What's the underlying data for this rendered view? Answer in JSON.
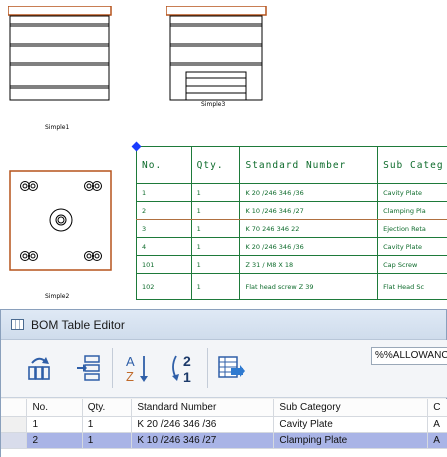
{
  "drawing": {
    "views": [
      {
        "name": "Simple1"
      },
      {
        "name": "Simple3"
      },
      {
        "name": "Simple2"
      }
    ],
    "bom_table": {
      "headers": [
        "No.",
        "Qty.",
        "Standard Number",
        "Sub Categ"
      ],
      "rows": [
        [
          "1",
          "1",
          "K 20 /246 346 /36",
          "Cavity Plate"
        ],
        [
          "2",
          "1",
          "K 10 /246 346 /27",
          "Clamping Pla"
        ],
        [
          "3",
          "1",
          "K 70 246 346 22",
          "Ejection Reta"
        ],
        [
          "4",
          "1",
          "K 20 /246 346 /36",
          "Cavity Plate"
        ],
        [
          "101",
          "1",
          "Z 31 / M8 X 18",
          "Cap Screw"
        ],
        [
          "102",
          "1",
          "Flat head screw Z 39",
          "Flat Head Sc"
        ]
      ]
    }
  },
  "bom_editor": {
    "title": "BOM Table Editor",
    "toolbar": {
      "allowance_value": "%%ALLOWANC",
      "icons": [
        "refresh-bom-icon",
        "column-edit-icon",
        "sort-alpha-icon",
        "sort-numeric-icon",
        "export-table-icon"
      ]
    },
    "columns": [
      "No.",
      "Qty.",
      "Standard Number",
      "Sub Category",
      "C"
    ],
    "rows": [
      {
        "no": "1",
        "qty": "1",
        "standard": "K 20 /246 346 /36",
        "sub": "Cavity Plate",
        "extra": "A",
        "selected": false
      },
      {
        "no": "2",
        "qty": "1",
        "standard": "K 10 /246 346 /27",
        "sub": "Clamping Plate",
        "extra": "A",
        "selected": true
      }
    ]
  }
}
